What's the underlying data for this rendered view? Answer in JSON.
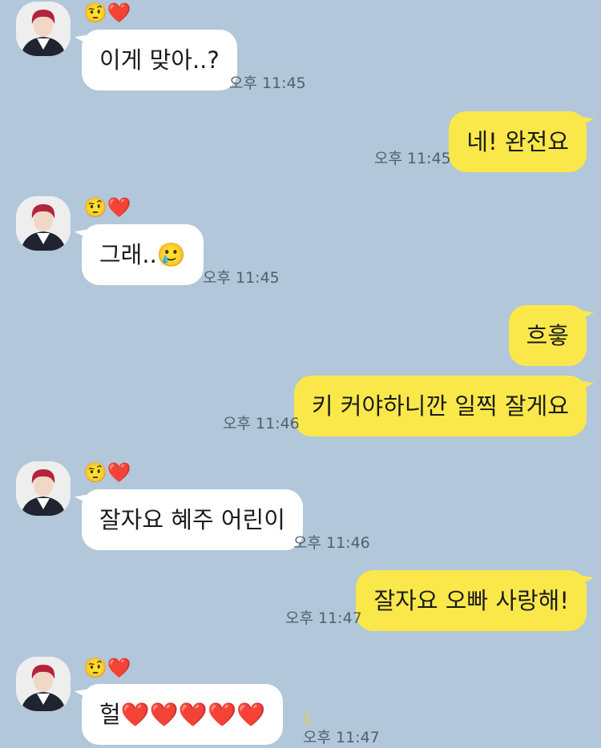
{
  "chat": {
    "sender": {
      "name_emoji": "🤨❤️"
    },
    "messages": [
      {
        "direction": "in",
        "text": "이게 맞아..?",
        "time": "오후 11:45",
        "show_profile": true
      },
      {
        "direction": "out",
        "text": "네! 완전요",
        "time": "오후 11:45"
      },
      {
        "direction": "in",
        "text": "그래..🥲",
        "time": "오후 11:45",
        "show_profile": true
      },
      {
        "direction": "out",
        "text": "흐흫",
        "time": ""
      },
      {
        "direction": "out",
        "text": "키 커야하니깐 일찍 잘게요",
        "time": "오후 11:46"
      },
      {
        "direction": "in",
        "text": "잘자요 혜주 어린이",
        "time": "오후 11:46",
        "show_profile": true
      },
      {
        "direction": "out",
        "text": "잘자요 오빠 사랑해!",
        "time": "오후 11:47"
      },
      {
        "direction": "in",
        "text": "헐❤️❤️❤️❤️❤️",
        "time": "오후 11:47",
        "unread": "1",
        "show_profile": true
      }
    ]
  },
  "colors": {
    "background": "#b2c7d9",
    "incoming_bubble": "#ffffff",
    "outgoing_bubble": "#fae84b",
    "unread_count": "#f2d31b"
  },
  "icons": {
    "avatar": "profile-photo"
  }
}
